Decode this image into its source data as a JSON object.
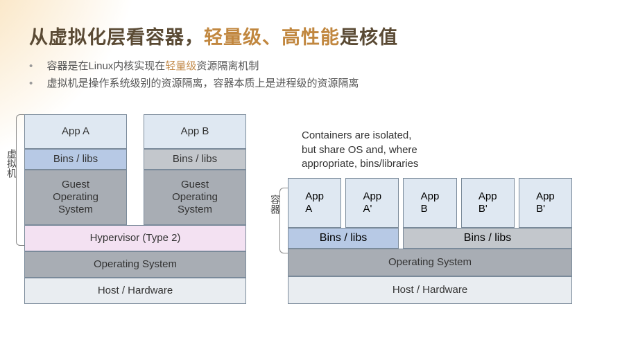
{
  "title": {
    "t1": "从虚拟化层看容器，",
    "t2": "轻量级、高性能",
    "t3": "是核值"
  },
  "bullets": [
    {
      "p1": "容器是在Linux内核实现在",
      "accent": "轻量级",
      "p2": "资源隔离机制"
    },
    {
      "p1": "虚拟机是操作系统级别的资源隔离，容器本质上是进程级的资源隔离",
      "accent": "",
      "p2": ""
    }
  ],
  "vm": {
    "label": "虚拟机",
    "appA": "App A",
    "appB": "App B",
    "binsA": "Bins / libs",
    "binsB": "Bins / libs",
    "guestA": "Guest\nOperating\nSystem",
    "guestB": "Guest\nOperating\nSystem",
    "hyper": "Hypervisor (Type 2)",
    "os": "Operating System",
    "host": "Host / Hardware"
  },
  "container": {
    "label": "容器",
    "note": "Containers are isolated,\nbut share OS and, where\nappropriate, bins/libraries",
    "apps": [
      "App\nA",
      "App\nA'",
      "App\nB",
      "App\nB'",
      "App\nB'"
    ],
    "binsL": "Bins / libs",
    "binsR": "Bins / libs",
    "os": "Operating System",
    "host": "Host / Hardware"
  }
}
